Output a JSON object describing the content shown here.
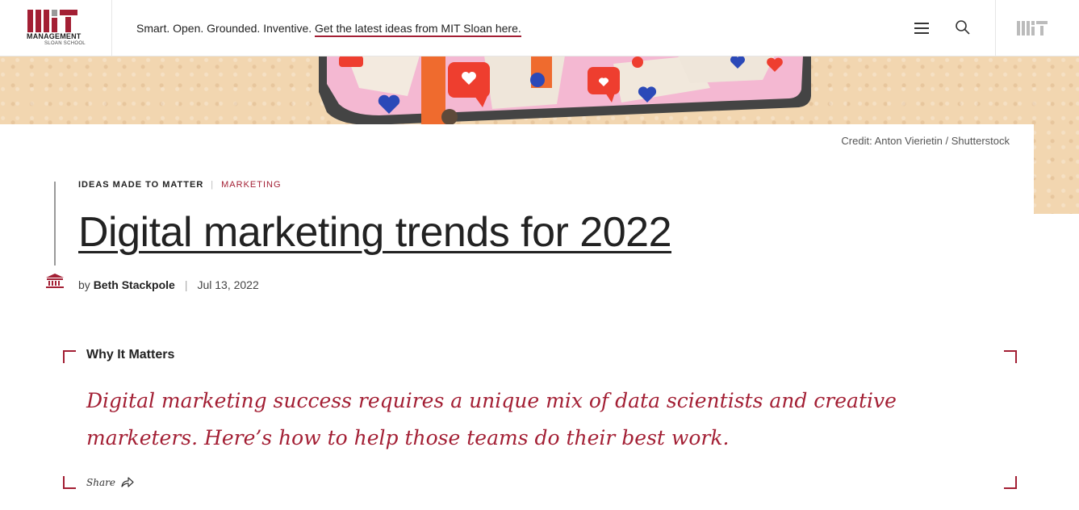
{
  "header": {
    "logo_main": "MANAGEMENT",
    "logo_sub": "SLOAN SCHOOL",
    "tagline": "Smart. Open. Grounded. Inventive.",
    "tagline_link": "Get the latest ideas from MIT Sloan here.",
    "menu_icon": "hamburger-menu-icon",
    "search_icon": "search-icon",
    "mit_logo": "mit-logo"
  },
  "hero": {
    "credit": "Credit: Anton Vierietin / Shutterstock"
  },
  "article": {
    "kicker_primary": "IDEAS MADE TO MATTER",
    "kicker_separator": "|",
    "kicker_category": "MARKETING",
    "title": "Digital marketing trends for 2022",
    "byline_prefix": "by",
    "author": "Beth Stackpole",
    "date": "Jul 13, 2022"
  },
  "why_it_matters": {
    "heading": "Why It Matters",
    "body": "Digital marketing success requires a unique mix of data scientists and creative marketers. Here’s how to help those teams do their best work.",
    "share_label": "Share"
  },
  "colors": {
    "brand_red": "#a31f34",
    "text_dark": "#222222",
    "hero_background": "#f2d6b0"
  }
}
